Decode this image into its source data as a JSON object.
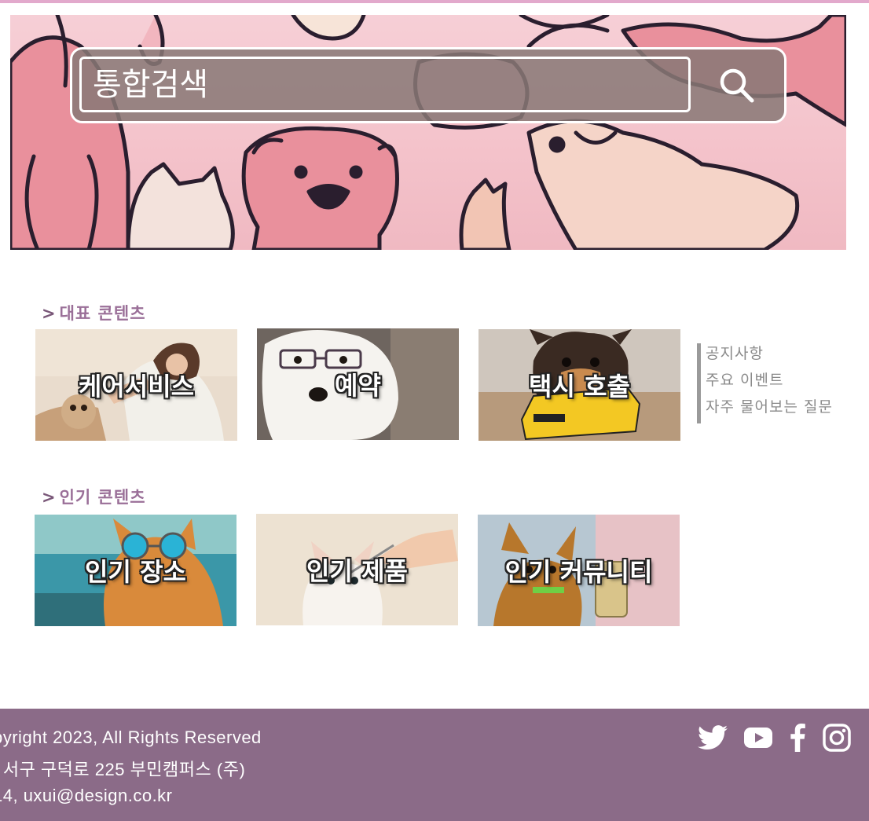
{
  "search": {
    "placeholder": "통합검색",
    "icon": "search-icon"
  },
  "sections": {
    "featured": {
      "chevron": ">",
      "title": "대표 콘텐츠",
      "cards": [
        {
          "label": "케어서비스"
        },
        {
          "label": "예약"
        },
        {
          "label": "택시 호출"
        }
      ]
    },
    "popular": {
      "chevron": ">",
      "title": "인기 콘텐츠",
      "cards": [
        {
          "label": "인기 장소"
        },
        {
          "label": "인기 제품"
        },
        {
          "label": "인기 커뮤니티"
        }
      ]
    }
  },
  "side_links": [
    {
      "label": "공지사항"
    },
    {
      "label": "주요 이벤트"
    },
    {
      "label": "자주 물어보는 질문"
    }
  ],
  "footer": {
    "lines": [
      "pyright 2023, All Rights Reserved",
      "| 서구 구덕로 225 부민캠퍼스 (주)",
      "14, uxui@design.co.kr"
    ],
    "social_icons": [
      "twitter-icon",
      "youtube-icon",
      "facebook-icon",
      "instagram-icon"
    ]
  },
  "colors": {
    "accent": "#9a6f98",
    "footer_bg": "#8b6b88",
    "top_line": "#e2a9cc",
    "hero_bg": "#f4c3cb"
  }
}
